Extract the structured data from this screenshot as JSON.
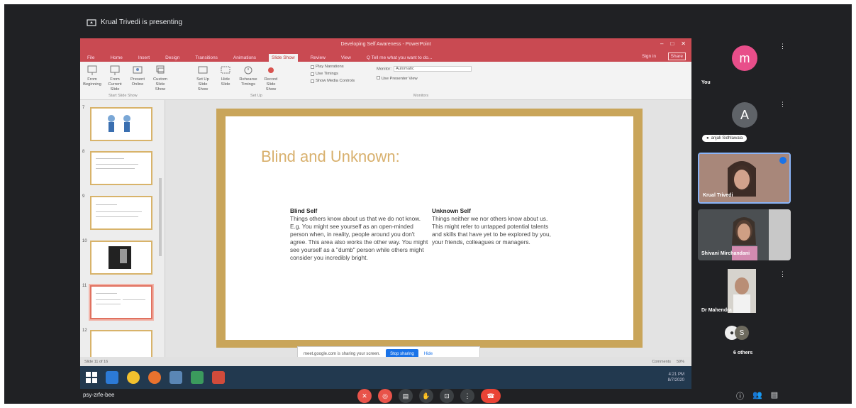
{
  "meet": {
    "presenting_text": "Krual Trivedi is presenting",
    "meeting_code": "psy-zrfe-bee",
    "others_count": "6 others"
  },
  "powerpoint": {
    "window_title": "Developing Self Awareness - PowerPoint",
    "tabs": [
      "File",
      "Home",
      "Insert",
      "Design",
      "Transitions",
      "Animations",
      "Slide Show",
      "Review",
      "View",
      "Q Tell me what you want to do..."
    ],
    "active_tab": "Slide Show",
    "signin": "Sign in",
    "share": "Share",
    "ribbon": {
      "from_beginning": "From Beginning",
      "from_current": "From Current Slide",
      "present_online": "Present Online",
      "custom_show": "Custom Slide Show",
      "group_start": "Start Slide Show",
      "setup": "Set Up Slide Show",
      "hide_slide": "Hide Slide",
      "rehearse": "Rehearse Timings",
      "record": "Record Slide Show",
      "group_setup": "Set Up",
      "play_narrations": "Play Narrations",
      "use_timings": "Use Timings",
      "show_media": "Show Media Controls",
      "monitor_label": "Monitor:",
      "monitor_value": "Automatic",
      "presenter_view": "Use Presenter View",
      "group_monitors": "Monitors"
    },
    "thumb_numbers": [
      "7",
      "8",
      "9",
      "10",
      "11",
      "12"
    ],
    "slide": {
      "title": "Blind and Unknown:",
      "blind_heading": "Blind Self",
      "blind_body": "Things others know about us that we do not know.\nE.g. You might see yourself as an open-minded person when, in reality, people around you don't agree. This area also works the other way. You might see yourself as a \"dumb\" person while others might consider you incredibly bright.",
      "unknown_heading": "Unknown Self",
      "unknown_body": "Things neither we nor others know about us.\nThis might refer to untapped potential talents and skills that have yet to be explored by you, your friends, colleagues or managers."
    },
    "status_slide": "Slide 11 of 16",
    "status_comments": "Comments",
    "status_zoom": "59%",
    "share_notice": "meet.google.com is sharing your screen.",
    "stop_sharing": "Stop sharing",
    "hide": "Hide",
    "tray_time": "4:21 PM",
    "tray_date": "8/7/2020"
  },
  "participants": [
    {
      "label": "You",
      "initial": "m",
      "color": "#e84e8a"
    },
    {
      "label": "anjali Sidhlawala",
      "initial": "A",
      "color": "#5f6368"
    },
    {
      "label": "Krual Trivedi"
    },
    {
      "label": "Shivani Mirchandani"
    },
    {
      "label": "Dr Mahendra"
    }
  ],
  "colors": {
    "ppt_red": "#c94a52",
    "slide_gold": "#c9a55a",
    "meet_bg": "#202124",
    "hangup": "#ea4335"
  }
}
